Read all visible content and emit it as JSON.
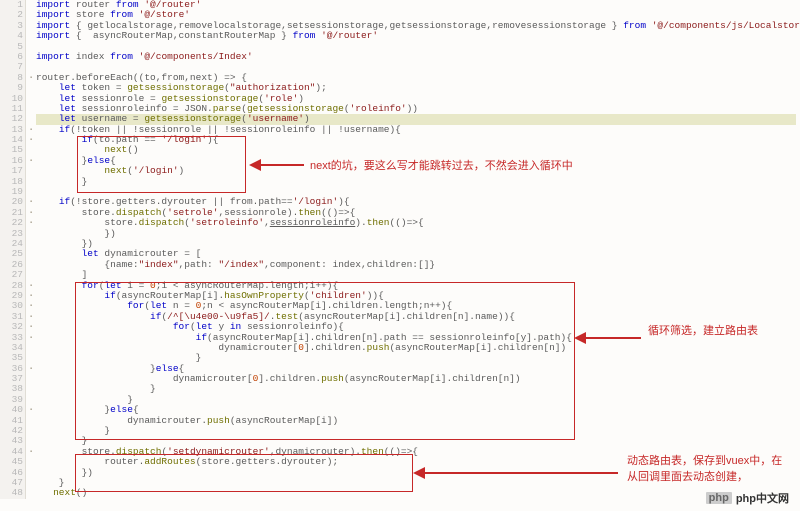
{
  "lines": [
    {
      "n": "1",
      "fold": false,
      "hl": false,
      "seg": [
        {
          "t": "import",
          "c": "kw"
        },
        {
          "t": " router "
        },
        {
          "t": "from",
          "c": "kw"
        },
        {
          "t": " "
        },
        {
          "t": "'@/router'",
          "c": "str"
        }
      ]
    },
    {
      "n": "2",
      "fold": false,
      "hl": false,
      "seg": [
        {
          "t": "import",
          "c": "kw"
        },
        {
          "t": " store "
        },
        {
          "t": "from",
          "c": "kw"
        },
        {
          "t": " "
        },
        {
          "t": "'@/store'",
          "c": "str"
        }
      ]
    },
    {
      "n": "3",
      "fold": false,
      "hl": false,
      "seg": [
        {
          "t": "import",
          "c": "kw"
        },
        {
          "t": " { getlocalstorage,removelocalstorage,setsessionstorage,getsessionstorage,removesessionstorage } "
        },
        {
          "t": "from",
          "c": "kw"
        },
        {
          "t": " "
        },
        {
          "t": "'@/components/js/Localstorage'",
          "c": "str"
        }
      ]
    },
    {
      "n": "4",
      "fold": false,
      "hl": false,
      "seg": [
        {
          "t": "import",
          "c": "kw"
        },
        {
          "t": " {  asyncRouterMap,constantRouterMap } "
        },
        {
          "t": "from",
          "c": "kw"
        },
        {
          "t": " "
        },
        {
          "t": "'@/router'",
          "c": "str"
        }
      ]
    },
    {
      "n": "5",
      "fold": false,
      "hl": false,
      "seg": [
        {
          "t": ""
        }
      ]
    },
    {
      "n": "6",
      "fold": false,
      "hl": false,
      "seg": [
        {
          "t": "import",
          "c": "kw"
        },
        {
          "t": " index "
        },
        {
          "t": "from",
          "c": "kw"
        },
        {
          "t": " "
        },
        {
          "t": "'@/components/Index'",
          "c": "str"
        }
      ]
    },
    {
      "n": "7",
      "fold": false,
      "hl": false,
      "seg": [
        {
          "t": ""
        }
      ]
    },
    {
      "n": "8",
      "fold": true,
      "hl": false,
      "seg": [
        {
          "t": "router.beforeEach((to,from,next) => {"
        }
      ]
    },
    {
      "n": "9",
      "fold": false,
      "hl": false,
      "seg": [
        {
          "t": "    "
        },
        {
          "t": "let",
          "c": "kw"
        },
        {
          "t": " token = "
        },
        {
          "t": "getsessionstorage",
          "c": "fn"
        },
        {
          "t": "("
        },
        {
          "t": "\"authorization\"",
          "c": "str"
        },
        {
          "t": ");"
        }
      ]
    },
    {
      "n": "10",
      "fold": false,
      "hl": false,
      "seg": [
        {
          "t": "    "
        },
        {
          "t": "let",
          "c": "kw"
        },
        {
          "t": " sessionrole = "
        },
        {
          "t": "getsessionstorage",
          "c": "fn"
        },
        {
          "t": "("
        },
        {
          "t": "'role'",
          "c": "str"
        },
        {
          "t": ")"
        }
      ]
    },
    {
      "n": "11",
      "fold": false,
      "hl": false,
      "seg": [
        {
          "t": "    "
        },
        {
          "t": "let",
          "c": "kw"
        },
        {
          "t": " sessionroleinfo = JSON."
        },
        {
          "t": "parse",
          "c": "fn"
        },
        {
          "t": "("
        },
        {
          "t": "getsessionstorage",
          "c": "fn"
        },
        {
          "t": "("
        },
        {
          "t": "'roleinfo'",
          "c": "str"
        },
        {
          "t": "))"
        }
      ]
    },
    {
      "n": "12",
      "fold": false,
      "hl": true,
      "seg": [
        {
          "t": "    "
        },
        {
          "t": "let",
          "c": "kw"
        },
        {
          "t": " username = "
        },
        {
          "t": "getsessionstorage",
          "c": "fn"
        },
        {
          "t": "("
        },
        {
          "t": "'username'",
          "c": "str"
        },
        {
          "t": ")"
        }
      ]
    },
    {
      "n": "13",
      "fold": true,
      "hl": false,
      "seg": [
        {
          "t": "    "
        },
        {
          "t": "if",
          "c": "kw"
        },
        {
          "t": "(!token || !sessionrole || !sessionroleinfo || !username){"
        }
      ]
    },
    {
      "n": "14",
      "fold": true,
      "hl": false,
      "seg": [
        {
          "t": "        "
        },
        {
          "t": "if",
          "c": "kw"
        },
        {
          "t": "(to.path == "
        },
        {
          "t": "'/login'",
          "c": "str"
        },
        {
          "t": "){"
        }
      ]
    },
    {
      "n": "15",
      "fold": false,
      "hl": false,
      "seg": [
        {
          "t": "            "
        },
        {
          "t": "next",
          "c": "fn"
        },
        {
          "t": "()"
        }
      ]
    },
    {
      "n": "16",
      "fold": true,
      "hl": false,
      "seg": [
        {
          "t": "        }"
        },
        {
          "t": "else",
          "c": "kw"
        },
        {
          "t": "{"
        }
      ]
    },
    {
      "n": "17",
      "fold": false,
      "hl": false,
      "seg": [
        {
          "t": "            "
        },
        {
          "t": "next",
          "c": "fn"
        },
        {
          "t": "("
        },
        {
          "t": "'/login'",
          "c": "str"
        },
        {
          "t": ")"
        }
      ]
    },
    {
      "n": "18",
      "fold": false,
      "hl": false,
      "seg": [
        {
          "t": "        }"
        }
      ]
    },
    {
      "n": "19",
      "fold": false,
      "hl": false,
      "seg": [
        {
          "t": ""
        }
      ]
    },
    {
      "n": "20",
      "fold": true,
      "hl": false,
      "seg": [
        {
          "t": "    "
        },
        {
          "t": "if",
          "c": "kw"
        },
        {
          "t": "(!store.getters.dyrouter || from.path=="
        },
        {
          "t": "'/login'",
          "c": "str"
        },
        {
          "t": "){"
        }
      ]
    },
    {
      "n": "21",
      "fold": true,
      "hl": false,
      "seg": [
        {
          "t": "        store."
        },
        {
          "t": "dispatch",
          "c": "fn"
        },
        {
          "t": "("
        },
        {
          "t": "'setrole'",
          "c": "str"
        },
        {
          "t": ",sessionrole)."
        },
        {
          "t": "then",
          "c": "fn"
        },
        {
          "t": "(()=>{"
        }
      ]
    },
    {
      "n": "22",
      "fold": true,
      "hl": false,
      "seg": [
        {
          "t": "            store."
        },
        {
          "t": "dispatch",
          "c": "fn"
        },
        {
          "t": "("
        },
        {
          "t": "'setroleinfo'",
          "c": "str"
        },
        {
          "t": ","
        },
        {
          "t": "sessionroleinfo",
          "c": "ul"
        },
        {
          "t": ")."
        },
        {
          "t": "then",
          "c": "fn"
        },
        {
          "t": "(()=>{"
        }
      ]
    },
    {
      "n": "23",
      "fold": false,
      "hl": false,
      "seg": [
        {
          "t": "            })"
        }
      ]
    },
    {
      "n": "24",
      "fold": false,
      "hl": false,
      "seg": [
        {
          "t": "        })"
        }
      ]
    },
    {
      "n": "25",
      "fold": false,
      "hl": false,
      "seg": [
        {
          "t": "        "
        },
        {
          "t": "let",
          "c": "kw"
        },
        {
          "t": " dynamicrouter = ["
        }
      ]
    },
    {
      "n": "26",
      "fold": false,
      "hl": false,
      "seg": [
        {
          "t": "            {name:"
        },
        {
          "t": "\"index\"",
          "c": "str"
        },
        {
          "t": ",path: "
        },
        {
          "t": "\"/index\"",
          "c": "str"
        },
        {
          "t": ",component: index,children:[]}"
        }
      ]
    },
    {
      "n": "27",
      "fold": false,
      "hl": false,
      "seg": [
        {
          "t": "        ]"
        }
      ]
    },
    {
      "n": "28",
      "fold": true,
      "hl": false,
      "seg": [
        {
          "t": "        "
        },
        {
          "t": "for",
          "c": "kw"
        },
        {
          "t": "("
        },
        {
          "t": "let",
          "c": "kw"
        },
        {
          "t": " i = "
        },
        {
          "t": "0",
          "c": "nm"
        },
        {
          "t": ";i < asyncRouterMap.length;i++){"
        }
      ]
    },
    {
      "n": "29",
      "fold": true,
      "hl": false,
      "seg": [
        {
          "t": "            "
        },
        {
          "t": "if",
          "c": "kw"
        },
        {
          "t": "(asyncRouterMap[i]."
        },
        {
          "t": "hasOwnProperty",
          "c": "fn"
        },
        {
          "t": "("
        },
        {
          "t": "'children'",
          "c": "str"
        },
        {
          "t": ")){"
        }
      ]
    },
    {
      "n": "30",
      "fold": true,
      "hl": false,
      "seg": [
        {
          "t": "                "
        },
        {
          "t": "for",
          "c": "kw"
        },
        {
          "t": "("
        },
        {
          "t": "let",
          "c": "kw"
        },
        {
          "t": " n = "
        },
        {
          "t": "0",
          "c": "nm"
        },
        {
          "t": ";n < asyncRouterMap[i].children.length;n++){"
        }
      ]
    },
    {
      "n": "31",
      "fold": true,
      "hl": false,
      "seg": [
        {
          "t": "                    "
        },
        {
          "t": "if",
          "c": "kw"
        },
        {
          "t": "("
        },
        {
          "t": "/^[\\u4e00-\\u9fa5]/",
          "c": "str"
        },
        {
          "t": "."
        },
        {
          "t": "test",
          "c": "fn"
        },
        {
          "t": "(asyncRouterMap[i].children[n].name)){"
        }
      ]
    },
    {
      "n": "32",
      "fold": true,
      "hl": false,
      "seg": [
        {
          "t": "                        "
        },
        {
          "t": "for",
          "c": "kw"
        },
        {
          "t": "("
        },
        {
          "t": "let",
          "c": "kw"
        },
        {
          "t": " y "
        },
        {
          "t": "in",
          "c": "kw"
        },
        {
          "t": " sessionroleinfo){"
        }
      ]
    },
    {
      "n": "33",
      "fold": true,
      "hl": false,
      "seg": [
        {
          "t": "                            "
        },
        {
          "t": "if",
          "c": "kw"
        },
        {
          "t": "(asyncRouterMap[i].children[n].path == sessionroleinfo[y].path){"
        }
      ]
    },
    {
      "n": "34",
      "fold": false,
      "hl": false,
      "seg": [
        {
          "t": "                                dynamicrouter["
        },
        {
          "t": "0",
          "c": "nm"
        },
        {
          "t": "].children."
        },
        {
          "t": "push",
          "c": "fn"
        },
        {
          "t": "(asyncRouterMap[i].children[n])"
        }
      ]
    },
    {
      "n": "35",
      "fold": false,
      "hl": false,
      "seg": [
        {
          "t": "                            }"
        }
      ]
    },
    {
      "n": "36",
      "fold": true,
      "hl": false,
      "seg": [
        {
          "t": "                    }"
        },
        {
          "t": "else",
          "c": "kw"
        },
        {
          "t": "{"
        }
      ]
    },
    {
      "n": "37",
      "fold": false,
      "hl": false,
      "seg": [
        {
          "t": "                        dynamicrouter["
        },
        {
          "t": "0",
          "c": "nm"
        },
        {
          "t": "].children."
        },
        {
          "t": "push",
          "c": "fn"
        },
        {
          "t": "(asyncRouterMap[i].children[n])"
        }
      ]
    },
    {
      "n": "38",
      "fold": false,
      "hl": false,
      "seg": [
        {
          "t": "                    }"
        }
      ]
    },
    {
      "n": "39",
      "fold": false,
      "hl": false,
      "seg": [
        {
          "t": "                }"
        }
      ]
    },
    {
      "n": "40",
      "fold": true,
      "hl": false,
      "seg": [
        {
          "t": "            }"
        },
        {
          "t": "else",
          "c": "kw"
        },
        {
          "t": "{"
        }
      ]
    },
    {
      "n": "41",
      "fold": false,
      "hl": false,
      "seg": [
        {
          "t": "                dynamicrouter."
        },
        {
          "t": "push",
          "c": "fn"
        },
        {
          "t": "(asyncRouterMap[i])"
        }
      ]
    },
    {
      "n": "42",
      "fold": false,
      "hl": false,
      "seg": [
        {
          "t": "            }"
        }
      ]
    },
    {
      "n": "43",
      "fold": false,
      "hl": false,
      "seg": [
        {
          "t": "        }"
        }
      ]
    },
    {
      "n": "44",
      "fold": true,
      "hl": false,
      "seg": [
        {
          "t": "        store."
        },
        {
          "t": "dispatch",
          "c": "fn"
        },
        {
          "t": "("
        },
        {
          "t": "'setdynamicrouter'",
          "c": "str"
        },
        {
          "t": ",dynamicrouter)."
        },
        {
          "t": "then",
          "c": "fn"
        },
        {
          "t": "(()=>{"
        }
      ]
    },
    {
      "n": "45",
      "fold": false,
      "hl": false,
      "seg": [
        {
          "t": "            router."
        },
        {
          "t": "addRoutes",
          "c": "fn"
        },
        {
          "t": "(store.getters.dyrouter);"
        }
      ]
    },
    {
      "n": "46",
      "fold": false,
      "hl": false,
      "seg": [
        {
          "t": "        })"
        }
      ]
    },
    {
      "n": "47",
      "fold": false,
      "hl": false,
      "seg": [
        {
          "t": "    }"
        }
      ]
    },
    {
      "n": "48",
      "fold": false,
      "hl": false,
      "seg": [
        {
          "t": "   "
        },
        {
          "t": "next",
          "c": "fn"
        },
        {
          "t": "()"
        }
      ]
    }
  ],
  "annot1": "next的坑，要这么写才能跳转过去，不然会进入循环中",
  "annot2": "循环筛选，建立路由表",
  "annot3": "动态路由表，保存到vuex中，在\n从回调里面去动态创建，",
  "watermark": {
    "logo": "php",
    "text": "php中文网"
  }
}
